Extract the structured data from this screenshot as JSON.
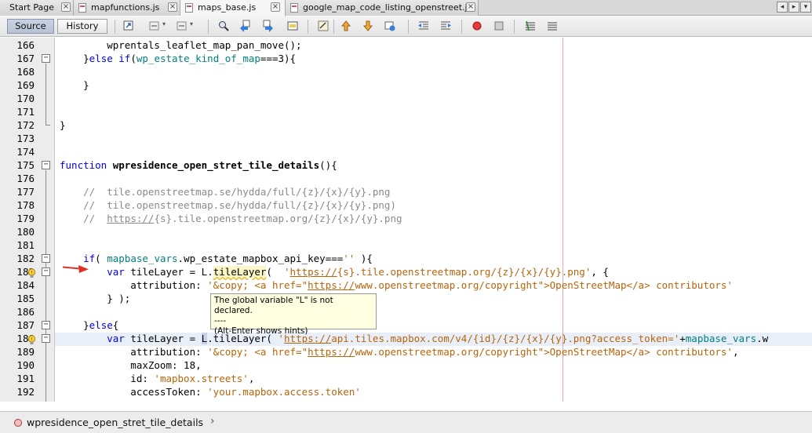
{
  "tabs": [
    {
      "label": "Start Page",
      "active": false,
      "has_file_icon": false
    },
    {
      "label": "mapfunctions.js",
      "active": false,
      "has_file_icon": true
    },
    {
      "label": "maps_base.js",
      "active": true,
      "has_file_icon": true
    },
    {
      "label": "google_map_code_listing_openstreet.js",
      "active": false,
      "has_file_icon": true
    }
  ],
  "tab_close_glyph": "×",
  "toolbar": {
    "source_label": "Source",
    "history_label": "History"
  },
  "line_numbers": [
    "166",
    "167",
    "168",
    "169",
    "170",
    "171",
    "172",
    "173",
    "174",
    "175",
    "176",
    "177",
    "178",
    "179",
    "180",
    "181",
    "182",
    "183",
    "184",
    "185",
    "186",
    "187",
    "188",
    "189",
    "190",
    "191",
    "192"
  ],
  "code_lines": [
    "        wprentals_leaflet_map_pan_move();",
    "    }else if(wp_estate_kind_of_map===3){",
    "",
    "    }",
    "",
    "",
    "}",
    "",
    "",
    "function wpresidence_open_stret_tile_details(){",
    "",
    "    //  tile.openstreetmap.se/hydda/full/{z}/{x}/{y}.png",
    "    //  tile.openstreetmap.se/hydda/full/{z}/{x}/{y}.png)",
    "    //  https://{s}.tile.openstreetmap.org/{z}/{x}/{y}.png",
    "",
    "",
    "    if( mapbase_vars.wp_estate_mapbox_api_key==='' ){",
    "        var tileLayer = L.tileLayer(  'https://{s}.tile.openstreetmap.org/{z}/{x}/{y}.png', {",
    "            attribution: '&copy; <a href=\"https://www.openstreetmap.org/copyright\">OpenStreetMap</a> contributors'",
    "        } );",
    "",
    "    }else{",
    "        var tileLayer = L.tileLayer( 'https://api.tiles.mapbox.com/v4/{id}/{z}/{x}/{y}.png?access_token='+mapbase_vars.w",
    "            attribution: '&copy; <a href=\"https://www.openstreetmap.org/copyright\">OpenStreetMap</a> contributors',",
    "            maxZoom: 18,",
    "            id: 'mapbox.streets',",
    "            accessToken: 'your.mapbox.access.token'"
  ],
  "tooltip": {
    "line1": "The global variable \"L\" is not declared.",
    "line2": "----",
    "line3": "(Alt-Enter shows hints)"
  },
  "fold_glyph": "−",
  "status": {
    "breadcrumb": "wpresidence_open_stret_tile_details",
    "chevron": "›"
  },
  "icons": [
    "toggle-bookmark-icon",
    "back-icon",
    "forward-icon",
    "find-icon",
    "find-previous-icon",
    "find-next-icon",
    "find-selection-icon",
    "toggle-highlight-icon",
    "previous-bookmark-icon",
    "next-bookmark-icon",
    "toggle-bookmark2-icon",
    "shift-left-icon",
    "shift-right-icon",
    "start-macro-icon",
    "stop-macro-icon",
    "comment-icon",
    "uncomment-icon"
  ],
  "colors": {
    "keyword": "#0000e6",
    "global_var": "#008080",
    "string": "#b8640a",
    "comment": "#8a8a8a",
    "current_line": "#e9eff8",
    "arrow": "#e0302a"
  }
}
